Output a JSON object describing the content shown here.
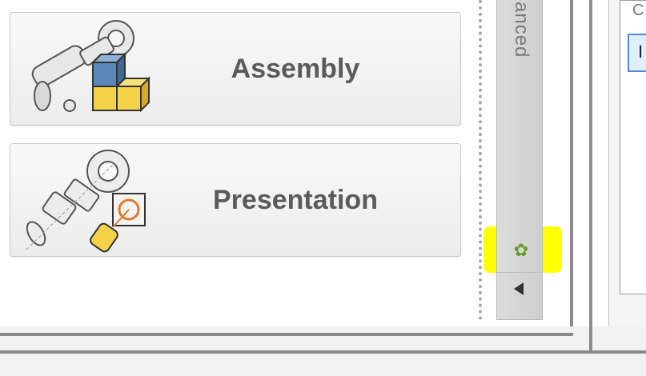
{
  "tiles": [
    {
      "label": "Assembly",
      "icon": "assembly-icon"
    },
    {
      "label": "Presentation",
      "icon": "presentation-icon"
    }
  ],
  "side_tab": {
    "text": "anced",
    "settings_icon": "gear-icon",
    "collapse_icon": "arrow-left-icon"
  },
  "right_panel": {
    "header_glyph": "C",
    "selected_glyph": "I"
  },
  "colors": {
    "highlight": "#ffff00",
    "gear": "#6a9a2a",
    "selection_border": "#4a8ee0"
  }
}
